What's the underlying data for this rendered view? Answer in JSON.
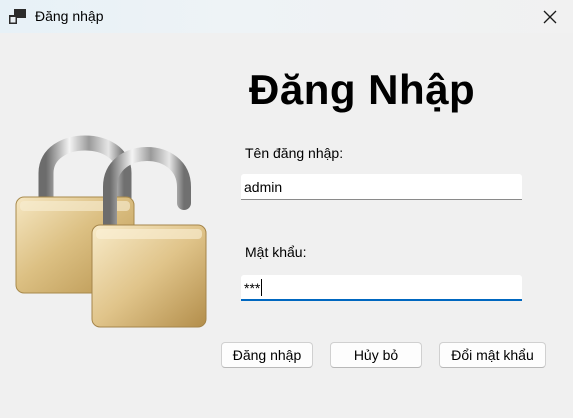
{
  "window": {
    "title": "Đăng nhập",
    "icon": "app-window-icon",
    "close_icon": "close-icon"
  },
  "form": {
    "heading": "Đăng Nhập",
    "username_label": "Tên đăng nhập:",
    "username_value": "admin",
    "password_label": "Mật khẩu:",
    "password_value": "***",
    "image": "padlocks-icon"
  },
  "buttons": {
    "login": "Đăng nhập",
    "cancel": "Hủy bỏ",
    "change_password": "Đổi mật khẩu"
  },
  "colors": {
    "focus_accent": "#0067c0",
    "background": "#f0f0f0"
  }
}
